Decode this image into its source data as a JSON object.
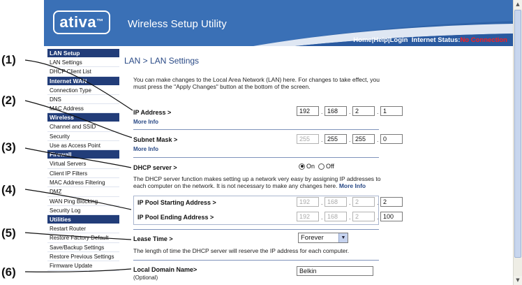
{
  "callouts": [
    "(1)",
    "(2)",
    "(3)",
    "(4)",
    "(5)",
    "(6)"
  ],
  "header": {
    "logo": "ativa",
    "logo_mark": "™",
    "app_title": "Wireless Setup Utility",
    "links": {
      "home": "Home",
      "sep1": " |",
      "help": "Help",
      "sep2": " |",
      "login": "Login",
      "status_label": "  Internet Status:",
      "status_value": "No Connection"
    }
  },
  "colors": {
    "header_bg": "#2f63a8",
    "sidebar_head": "#223d79",
    "status_red": "#ff1c1c",
    "link_blue": "#2a4a86"
  },
  "sidebar": {
    "sections": [
      {
        "title": "LAN Setup",
        "items": [
          "LAN Settings",
          "DHCP Client List"
        ]
      },
      {
        "title": "Internet WAN",
        "items": [
          "Connection Type",
          "DNS",
          "MAC Address"
        ]
      },
      {
        "title": "Wireless",
        "items": [
          "Channel and SSID",
          "Security",
          "Use as Access Point"
        ]
      },
      {
        "title": "Firewall",
        "items": [
          "Virtual Servers",
          "Client IP Filters",
          "MAC Address Filtering",
          "DMZ",
          "WAN Ping Blocking",
          "Security Log"
        ]
      },
      {
        "title": "Utilities",
        "items": [
          "Restart Router",
          "Restore Factory Default",
          "Save/Backup Settings",
          "Restore Previous Settings",
          "Firmware Update"
        ]
      }
    ]
  },
  "main": {
    "title": "LAN > LAN Settings",
    "intro": "You can make changes to the Local Area Network (LAN) here. For changes to take effect, you must press the \"Apply Changes\" button at the bottom of the screen.",
    "ip_address": {
      "label": "IP Address >",
      "more": "More Info",
      "octets": [
        "192",
        "168",
        "2",
        "1"
      ]
    },
    "subnet_mask": {
      "label": "Subnet Mask >",
      "more": "More Info",
      "octets": [
        "255",
        "255",
        "255",
        "0"
      ]
    },
    "dhcp": {
      "label": "DHCP server >",
      "on": "On",
      "off": "Off",
      "desc": "The DHCP server function makes setting up a network very easy by assigning IP addresses to each computer on the network. It is not necessary to make any changes here.",
      "more": "More Info"
    },
    "pool_start": {
      "label": "IP Pool Starting Address >",
      "octets": [
        "192",
        "168",
        "2",
        "2"
      ]
    },
    "pool_end": {
      "label": "IP Pool Ending Address >",
      "octets": [
        "192",
        "168",
        "2",
        "100"
      ]
    },
    "lease": {
      "label": "Lease Time >",
      "value": "Forever",
      "desc": "The length of time the DHCP server will reserve the IP address for each computer."
    },
    "domain": {
      "label": "Local Domain Name>",
      "sub": "(Optional)",
      "value": "Belkin"
    }
  }
}
